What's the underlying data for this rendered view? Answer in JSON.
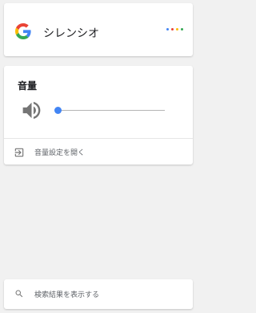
{
  "query": {
    "text": "シレンシオ"
  },
  "assistant_dots": [
    "#4285f4",
    "#ea4335",
    "#fbbc05",
    "#34a853"
  ],
  "volume": {
    "title": "音量",
    "level": 0,
    "accent": "#4285f4",
    "open_settings_label": "音量設定を開く",
    "speaker_icon": "speaker-icon",
    "open_icon": "open-in-icon"
  },
  "search": {
    "label": "検索結果を表示する",
    "icon": "search-icon"
  }
}
